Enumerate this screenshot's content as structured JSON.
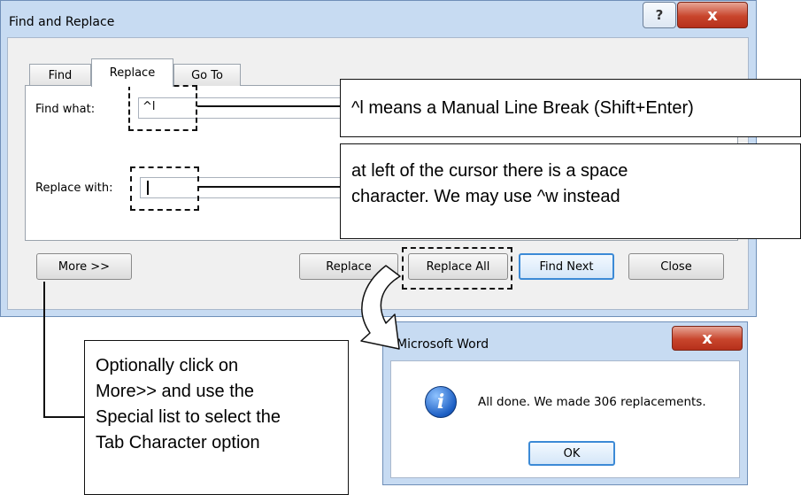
{
  "find_replace": {
    "title": "Find and Replace",
    "help_glyph": "?",
    "close_glyph": "x",
    "tabs": [
      {
        "label": "Find",
        "active": false
      },
      {
        "label": "Replace",
        "active": true
      },
      {
        "label": "Go To",
        "active": false
      }
    ],
    "find_label": "Find what:",
    "find_value": "^l",
    "replace_label": "Replace with:",
    "replace_value": "",
    "buttons": {
      "more": "More >>",
      "replace": "Replace",
      "replace_all": "Replace All",
      "find_next": "Find Next",
      "close": "Close"
    }
  },
  "callouts": {
    "find": "^l means a Manual Line Break (Shift+Enter)",
    "replace": [
      "at left of the cursor there is a space",
      "character. We may use ^w instead"
    ],
    "more": [
      "Optionally click on",
      "More>> and use the",
      "Special list to select the",
      "Tab Character option"
    ]
  },
  "message_box": {
    "title": "Microsoft Word",
    "close_glyph": "x",
    "icon": "info-icon",
    "icon_glyph": "i",
    "message": "All done. We made 306 replacements.",
    "ok": "OK"
  },
  "colors": {
    "window_frame": "#c7dbf2",
    "close_button": "#c8452c",
    "focus_border": "#3c8ad6"
  }
}
